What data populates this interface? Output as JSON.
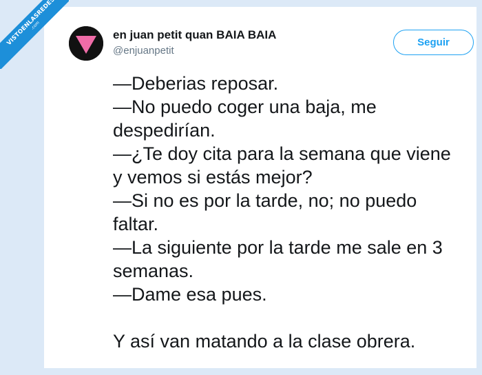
{
  "watermark": {
    "text": "VISTOENLASREDES",
    "sub": ".com",
    "color": "#1d8fd9"
  },
  "tweet": {
    "display_name": "en juan petit quan BAIA BAIA",
    "handle": "@enjuanpetit",
    "follow_label": "Seguir",
    "avatar_icon": "pink-triangle-icon",
    "more_icon": "chevron-down-icon",
    "accent_color": "#1da1f2",
    "lines": [
      "—Deberias reposar.",
      "—No puedo coger una baja, me",
      "despedirían.",
      "—¿Te doy cita para la semana que viene",
      "y vemos si estás mejor?",
      "—Si no es por la tarde, no; no puedo",
      "faltar.",
      "—La siguiente por la tarde me sale en 3",
      "semanas.",
      "—Dame esa pues."
    ],
    "closing_line": "Y así van matando a la clase obrera."
  }
}
